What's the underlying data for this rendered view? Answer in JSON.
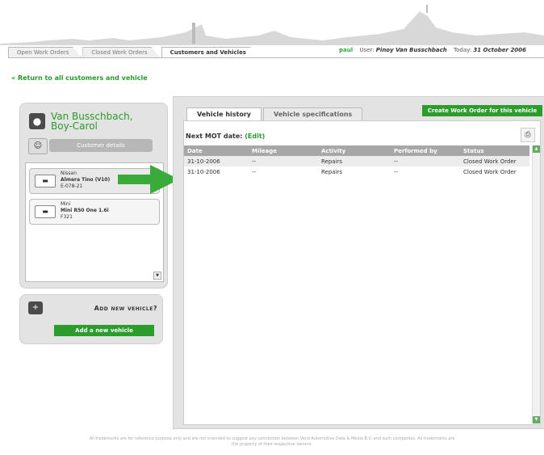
{
  "top_tabs": [
    {
      "label": "Open Work Orders",
      "active": false
    },
    {
      "label": "Closed Work Orders",
      "active": false
    },
    {
      "label": "Customers and Vehicles",
      "active": true
    }
  ],
  "user_bar": {
    "username": "paul",
    "user_label": "User:",
    "user_name": "Pinoy Van Busschbach",
    "today_label": "Today:",
    "today_value": "31 October 2006"
  },
  "back_link": "« Return to all customers and vehicle",
  "customer": {
    "name_line1": "Van Busschbach,",
    "name_line2": "Boy-Carol",
    "details_button": "Customer details"
  },
  "vehicles": [
    {
      "make": "Nissan",
      "model": "Almera Tino (V10)",
      "plate": "E-078-21"
    },
    {
      "make": "Mini",
      "model": "Mini R50 One 1.6i",
      "plate": "F321"
    }
  ],
  "add_vehicle": {
    "title": "Add new vehicle?",
    "button": "Add a new vehicle"
  },
  "vehicle_tabs": [
    {
      "label": "Vehicle history",
      "active": true
    },
    {
      "label": "Vehicle specifications",
      "active": false
    }
  ],
  "create_work_order_button": "Create Work Order for this vehicle",
  "mot": {
    "label": "Next MOT date:",
    "edit": "(Edit)"
  },
  "history_table": {
    "columns": [
      "Date",
      "Mileage",
      "Activity",
      "Performed by",
      "Status"
    ],
    "rows": [
      [
        "31-10-2006",
        "--",
        "Repairs",
        "--",
        "Closed Work Order"
      ],
      [
        "31-10-2006",
        "--",
        "Repairs",
        "--",
        "Closed Work Order"
      ]
    ]
  },
  "footer": {
    "line1": "All trademarks are for reference purpose only and are not intended to suggest any connection between Vecd Automotive Data & Media B.V. and such companies. All trademarks are",
    "line2": "the property of their respective owners."
  },
  "colors": {
    "accent_green": "#2c9c2c",
    "panel_gray": "#e3e3e3",
    "header_gray": "#a7a7a7"
  }
}
